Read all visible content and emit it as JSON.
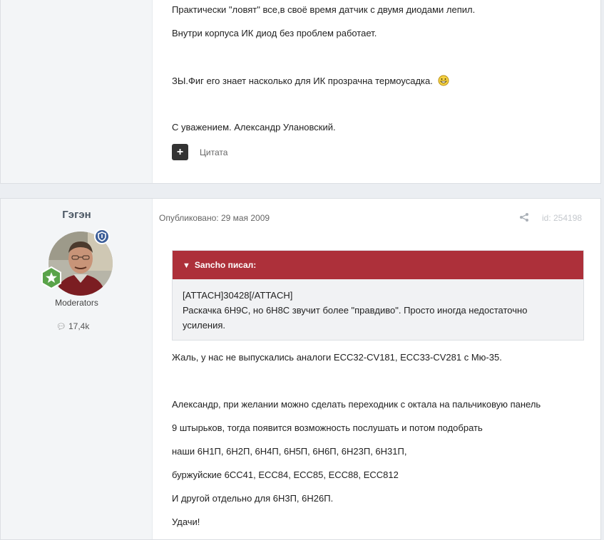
{
  "post1": {
    "lines": [
      "Практически \"ловят\" все,в своё время датчик с двумя диодами лепил.",
      "Внутри корпуса ИК диод без проблем работает.",
      "ЗЫ.Фиг его знает насколько для ИК прозрачна термоусадка.",
      "С уважением. Александр Улановский."
    ],
    "quote_button_label": "Цитата"
  },
  "post2": {
    "author": "Гэгэн",
    "role": "Moderators",
    "post_count": "17,4k",
    "published": "Опубликовано: 29 мая 2009",
    "post_id": "id: 254198",
    "quote": {
      "header": "Sancho писал:",
      "line1": "[ATTACH]30428[/ATTACH]",
      "line2": "Раскачка 6Н9С, но 6Н8С звучит более \"правдиво\". Просто иногда недостаточно",
      "line3": "усиления."
    },
    "lines": [
      "Жаль, у нас не выпускались аналоги ЕСС32-CV181, ЕСС33-CV281 с Мю-35.",
      "Александр, при желании можно сделать переходник с октала на пальчиковую панель",
      "9 штырьков, тогда появится возможность послушать и потом подобрать",
      "наши 6Н1П, 6Н2П, 6Н4П, 6Н5П, 6Н6П, 6Н23П, 6Н31П,",
      "буржуйские 6СС41, ЕСС84, ЕСС85, ЕСС88, ЕСС812",
      "И другой отдельно для 6Н3П, 6Н26П.",
      "Удачи!"
    ]
  },
  "icons": {
    "emoji": "grin-emoji-icon",
    "quote": "plus-icon",
    "share": "share-icon",
    "comment": "comment-icon",
    "moderator": "shield-icon",
    "rank": "star-badge-icon"
  },
  "colors": {
    "quote_header": "#ad303a",
    "moderator_badge": "#3c5e99",
    "rank_badge": "#5aa34a",
    "author_name": "#4a5663"
  }
}
